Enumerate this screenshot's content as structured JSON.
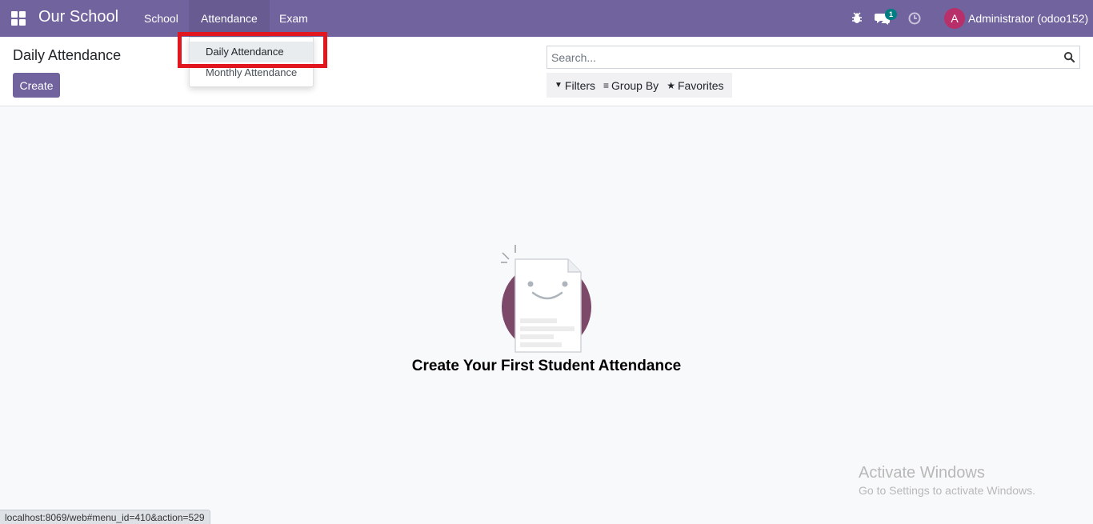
{
  "navbar": {
    "brand": "Our School",
    "menus": [
      "School",
      "Attendance",
      "Exam"
    ],
    "chat_badge": "1",
    "avatar_letter": "A",
    "user": "Administrator (odoo152)"
  },
  "control_panel": {
    "breadcrumb": "Daily Attendance",
    "create_label": "Create",
    "search_placeholder": "Search...",
    "filters_label": "Filters",
    "groupby_label": "Group By",
    "favorites_label": "Favorites"
  },
  "dropdown": {
    "items": [
      "Daily Attendance",
      "Monthly Attendance"
    ]
  },
  "helper": {
    "title": "Create Your First Student Attendance"
  },
  "watermark": {
    "title": "Activate Windows",
    "subtitle": "Go to Settings to activate Windows."
  },
  "status_url": "localhost:8069/web#menu_id=410&action=529",
  "colors": {
    "navbar": "#71639e",
    "highlight": "#e2161e",
    "avatar": "#b8306a",
    "badge": "#017e84"
  }
}
